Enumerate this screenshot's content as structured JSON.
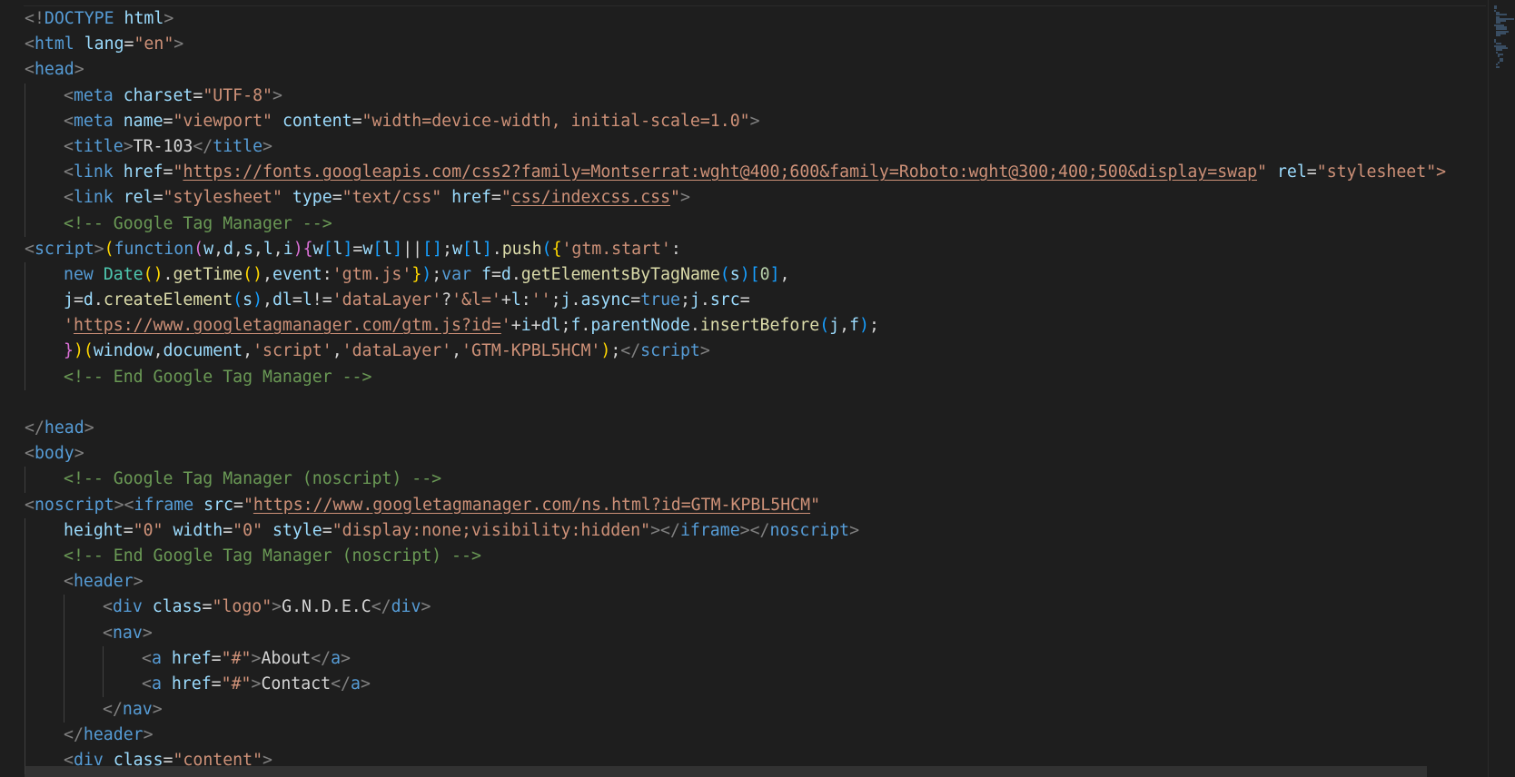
{
  "lines": [
    {
      "indent": 0,
      "tokens": [
        [
          "t-p",
          "<!"
        ],
        [
          "t-tag",
          "DOCTYPE"
        ],
        [
          "t-txt",
          " "
        ],
        [
          "t-attr",
          "html"
        ],
        [
          "t-p",
          ">"
        ]
      ]
    },
    {
      "indent": 0,
      "tokens": [
        [
          "t-p",
          "<"
        ],
        [
          "t-tag",
          "html"
        ],
        [
          "t-txt",
          " "
        ],
        [
          "t-attr",
          "lang"
        ],
        [
          "t-eq",
          "="
        ],
        [
          "t-str",
          "\"en\""
        ],
        [
          "t-p",
          ">"
        ]
      ]
    },
    {
      "indent": 0,
      "tokens": [
        [
          "t-p",
          "<"
        ],
        [
          "t-tag",
          "head"
        ],
        [
          "t-p",
          ">"
        ]
      ]
    },
    {
      "indent": 1,
      "tokens": [
        [
          "t-p",
          "<"
        ],
        [
          "t-tag",
          "meta"
        ],
        [
          "t-txt",
          " "
        ],
        [
          "t-attr",
          "charset"
        ],
        [
          "t-eq",
          "="
        ],
        [
          "t-str",
          "\"UTF-8\""
        ],
        [
          "t-p",
          ">"
        ]
      ]
    },
    {
      "indent": 1,
      "tokens": [
        [
          "t-p",
          "<"
        ],
        [
          "t-tag",
          "meta"
        ],
        [
          "t-txt",
          " "
        ],
        [
          "t-attr",
          "name"
        ],
        [
          "t-eq",
          "="
        ],
        [
          "t-str",
          "\"viewport\""
        ],
        [
          "t-txt",
          " "
        ],
        [
          "t-attr",
          "content"
        ],
        [
          "t-eq",
          "="
        ],
        [
          "t-str",
          "\"width=device-width, initial-scale=1.0\""
        ],
        [
          "t-p",
          ">"
        ]
      ]
    },
    {
      "indent": 1,
      "tokens": [
        [
          "t-p",
          "<"
        ],
        [
          "t-tag",
          "title"
        ],
        [
          "t-p",
          ">"
        ],
        [
          "t-txt",
          "TR-103"
        ],
        [
          "t-p",
          "</"
        ],
        [
          "t-tag",
          "title"
        ],
        [
          "t-p",
          ">"
        ]
      ]
    },
    {
      "indent": 1,
      "tokens": [
        [
          "t-p",
          "<"
        ],
        [
          "t-tag",
          "link"
        ],
        [
          "t-txt",
          " "
        ],
        [
          "t-attr",
          "href"
        ],
        [
          "t-eq",
          "="
        ],
        [
          "t-str",
          "\""
        ],
        [
          "t-url",
          "https://fonts.googleapis.com/css2?family=Montserrat:wght@400;600&family=Roboto:wght@300;400;500&display=swap"
        ],
        [
          "t-str",
          "\""
        ],
        [
          "t-txt",
          " "
        ],
        [
          "t-attr",
          "rel"
        ],
        [
          "t-eq",
          "="
        ],
        [
          "t-str",
          "\"stylesheet\">"
        ]
      ]
    },
    {
      "indent": 1,
      "tokens": [
        [
          "t-p",
          "<"
        ],
        [
          "t-tag",
          "link"
        ],
        [
          "t-txt",
          " "
        ],
        [
          "t-attr",
          "rel"
        ],
        [
          "t-eq",
          "="
        ],
        [
          "t-str",
          "\"stylesheet\""
        ],
        [
          "t-txt",
          " "
        ],
        [
          "t-attr",
          "type"
        ],
        [
          "t-eq",
          "="
        ],
        [
          "t-str",
          "\"text/css\""
        ],
        [
          "t-txt",
          " "
        ],
        [
          "t-attr",
          "href"
        ],
        [
          "t-eq",
          "="
        ],
        [
          "t-str",
          "\""
        ],
        [
          "t-url",
          "css/indexcss.css"
        ],
        [
          "t-str",
          "\""
        ],
        [
          "t-p",
          ">"
        ]
      ]
    },
    {
      "indent": 1,
      "tokens": [
        [
          "t-com",
          "<!-- Google Tag Manager -->"
        ]
      ]
    },
    {
      "indent": 0,
      "tokens": [
        [
          "t-p",
          "<"
        ],
        [
          "t-tag",
          "script"
        ],
        [
          "t-p",
          ">"
        ],
        [
          "t-b1",
          "("
        ],
        [
          "t-kw",
          "function"
        ],
        [
          "t-b2",
          "("
        ],
        [
          "t-var",
          "w"
        ],
        [
          "t-op",
          ","
        ],
        [
          "t-var",
          "d"
        ],
        [
          "t-op",
          ","
        ],
        [
          "t-var",
          "s"
        ],
        [
          "t-op",
          ","
        ],
        [
          "t-var",
          "l"
        ],
        [
          "t-op",
          ","
        ],
        [
          "t-var",
          "i"
        ],
        [
          "t-b2",
          ")"
        ],
        [
          "t-b2",
          "{"
        ],
        [
          "t-var",
          "w"
        ],
        [
          "t-b3",
          "["
        ],
        [
          "t-var",
          "l"
        ],
        [
          "t-b3",
          "]"
        ],
        [
          "t-op",
          "="
        ],
        [
          "t-var",
          "w"
        ],
        [
          "t-b3",
          "["
        ],
        [
          "t-var",
          "l"
        ],
        [
          "t-b3",
          "]"
        ],
        [
          "t-op",
          "||"
        ],
        [
          "t-b3",
          "[]"
        ],
        [
          "t-op",
          ";"
        ],
        [
          "t-var",
          "w"
        ],
        [
          "t-b3",
          "["
        ],
        [
          "t-var",
          "l"
        ],
        [
          "t-b3",
          "]"
        ],
        [
          "t-op",
          "."
        ],
        [
          "t-fn",
          "push"
        ],
        [
          "t-b3",
          "("
        ],
        [
          "t-b1",
          "{"
        ],
        [
          "t-str",
          "'gtm.start'"
        ],
        [
          "t-op",
          ":"
        ]
      ]
    },
    {
      "indent": 1,
      "tokens": [
        [
          "t-kw",
          "new"
        ],
        [
          "t-txt",
          " "
        ],
        [
          "t-cls",
          "Date"
        ],
        [
          "t-b1",
          "()"
        ],
        [
          "t-op",
          "."
        ],
        [
          "t-fn",
          "getTime"
        ],
        [
          "t-b1",
          "()"
        ],
        [
          "t-op",
          ","
        ],
        [
          "t-var",
          "event"
        ],
        [
          "t-op",
          ":"
        ],
        [
          "t-str",
          "'gtm.js'"
        ],
        [
          "t-b1",
          "}"
        ],
        [
          "t-b3",
          ")"
        ],
        [
          "t-op",
          ";"
        ],
        [
          "t-kw",
          "var"
        ],
        [
          "t-txt",
          " "
        ],
        [
          "t-var",
          "f"
        ],
        [
          "t-op",
          "="
        ],
        [
          "t-var",
          "d"
        ],
        [
          "t-op",
          "."
        ],
        [
          "t-fn",
          "getElementsByTagName"
        ],
        [
          "t-b3",
          "("
        ],
        [
          "t-var",
          "s"
        ],
        [
          "t-b3",
          ")"
        ],
        [
          "t-b3",
          "["
        ],
        [
          "t-num",
          "0"
        ],
        [
          "t-b3",
          "]"
        ],
        [
          "t-op",
          ","
        ]
      ]
    },
    {
      "indent": 1,
      "tokens": [
        [
          "t-var",
          "j"
        ],
        [
          "t-op",
          "="
        ],
        [
          "t-var",
          "d"
        ],
        [
          "t-op",
          "."
        ],
        [
          "t-fn",
          "createElement"
        ],
        [
          "t-b3",
          "("
        ],
        [
          "t-var",
          "s"
        ],
        [
          "t-b3",
          ")"
        ],
        [
          "t-op",
          ","
        ],
        [
          "t-var",
          "dl"
        ],
        [
          "t-op",
          "="
        ],
        [
          "t-var",
          "l"
        ],
        [
          "t-op",
          "!="
        ],
        [
          "t-str",
          "'dataLayer'"
        ],
        [
          "t-op",
          "?"
        ],
        [
          "t-str",
          "'&l='"
        ],
        [
          "t-op",
          "+"
        ],
        [
          "t-var",
          "l"
        ],
        [
          "t-op",
          ":"
        ],
        [
          "t-str",
          "''"
        ],
        [
          "t-op",
          ";"
        ],
        [
          "t-var",
          "j"
        ],
        [
          "t-op",
          "."
        ],
        [
          "t-var",
          "async"
        ],
        [
          "t-op",
          "="
        ],
        [
          "t-kw",
          "true"
        ],
        [
          "t-op",
          ";"
        ],
        [
          "t-var",
          "j"
        ],
        [
          "t-op",
          "."
        ],
        [
          "t-var",
          "src"
        ],
        [
          "t-op",
          "="
        ]
      ]
    },
    {
      "indent": 1,
      "tokens": [
        [
          "t-str",
          "'"
        ],
        [
          "t-url",
          "https://www.googletagmanager.com/gtm.js?id="
        ],
        [
          "t-str",
          "'"
        ],
        [
          "t-op",
          "+"
        ],
        [
          "t-var",
          "i"
        ],
        [
          "t-op",
          "+"
        ],
        [
          "t-var",
          "dl"
        ],
        [
          "t-op",
          ";"
        ],
        [
          "t-var",
          "f"
        ],
        [
          "t-op",
          "."
        ],
        [
          "t-var",
          "parentNode"
        ],
        [
          "t-op",
          "."
        ],
        [
          "t-fn",
          "insertBefore"
        ],
        [
          "t-b3",
          "("
        ],
        [
          "t-var",
          "j"
        ],
        [
          "t-op",
          ","
        ],
        [
          "t-var",
          "f"
        ],
        [
          "t-b3",
          ")"
        ],
        [
          "t-op",
          ";"
        ]
      ]
    },
    {
      "indent": 1,
      "tokens": [
        [
          "t-b2",
          "}"
        ],
        [
          "t-b1",
          ")"
        ],
        [
          "t-b1",
          "("
        ],
        [
          "t-var",
          "window"
        ],
        [
          "t-op",
          ","
        ],
        [
          "t-var",
          "document"
        ],
        [
          "t-op",
          ","
        ],
        [
          "t-str",
          "'script'"
        ],
        [
          "t-op",
          ","
        ],
        [
          "t-str",
          "'dataLayer'"
        ],
        [
          "t-op",
          ","
        ],
        [
          "t-str",
          "'GTM-KPBL5HCM'"
        ],
        [
          "t-b1",
          ")"
        ],
        [
          "t-op",
          ";"
        ],
        [
          "t-p",
          "</"
        ],
        [
          "t-tag",
          "script"
        ],
        [
          "t-p",
          ">"
        ]
      ]
    },
    {
      "indent": 1,
      "tokens": [
        [
          "t-com",
          "<!-- End Google Tag Manager -->"
        ]
      ]
    },
    {
      "indent": 0,
      "tokens": []
    },
    {
      "indent": 0,
      "tokens": [
        [
          "t-p",
          "</"
        ],
        [
          "t-tag",
          "head"
        ],
        [
          "t-p",
          ">"
        ]
      ]
    },
    {
      "indent": 0,
      "tokens": [
        [
          "t-p",
          "<"
        ],
        [
          "t-tag",
          "body"
        ],
        [
          "t-p",
          ">"
        ]
      ]
    },
    {
      "indent": 1,
      "tokens": [
        [
          "t-com",
          "<!-- Google Tag Manager (noscript) -->"
        ]
      ]
    },
    {
      "indent": 0,
      "tokens": [
        [
          "t-p",
          "<"
        ],
        [
          "t-tag",
          "noscript"
        ],
        [
          "t-p",
          ">"
        ],
        [
          "t-p",
          "<"
        ],
        [
          "t-tag",
          "iframe"
        ],
        [
          "t-txt",
          " "
        ],
        [
          "t-attr",
          "src"
        ],
        [
          "t-eq",
          "="
        ],
        [
          "t-str",
          "\""
        ],
        [
          "t-url",
          "https://www.googletagmanager.com/ns.html?id=GTM-KPBL5HCM"
        ],
        [
          "t-str",
          "\""
        ]
      ]
    },
    {
      "indent": 1,
      "tokens": [
        [
          "t-attr",
          "height"
        ],
        [
          "t-eq",
          "="
        ],
        [
          "t-str",
          "\"0\""
        ],
        [
          "t-txt",
          " "
        ],
        [
          "t-attr",
          "width"
        ],
        [
          "t-eq",
          "="
        ],
        [
          "t-str",
          "\"0\""
        ],
        [
          "t-txt",
          " "
        ],
        [
          "t-attr",
          "style"
        ],
        [
          "t-eq",
          "="
        ],
        [
          "t-str",
          "\"display:none;visibility:hidden\""
        ],
        [
          "t-p",
          ">"
        ],
        [
          "t-p",
          "</"
        ],
        [
          "t-tag",
          "iframe"
        ],
        [
          "t-p",
          ">"
        ],
        [
          "t-p",
          "</"
        ],
        [
          "t-tag",
          "noscript"
        ],
        [
          "t-p",
          ">"
        ]
      ]
    },
    {
      "indent": 1,
      "tokens": [
        [
          "t-com",
          "<!-- End Google Tag Manager (noscript) -->"
        ]
      ]
    },
    {
      "indent": 1,
      "tokens": [
        [
          "t-p",
          "<"
        ],
        [
          "t-tag",
          "header"
        ],
        [
          "t-p",
          ">"
        ]
      ]
    },
    {
      "indent": 2,
      "tokens": [
        [
          "t-p",
          "<"
        ],
        [
          "t-tag",
          "div"
        ],
        [
          "t-txt",
          " "
        ],
        [
          "t-attr",
          "class"
        ],
        [
          "t-eq",
          "="
        ],
        [
          "t-str",
          "\"logo\""
        ],
        [
          "t-p",
          ">"
        ],
        [
          "t-txt",
          "G.N.D.E.C"
        ],
        [
          "t-p",
          "</"
        ],
        [
          "t-tag",
          "div"
        ],
        [
          "t-p",
          ">"
        ]
      ]
    },
    {
      "indent": 2,
      "tokens": [
        [
          "t-p",
          "<"
        ],
        [
          "t-tag",
          "nav"
        ],
        [
          "t-p",
          ">"
        ]
      ]
    },
    {
      "indent": 3,
      "tokens": [
        [
          "t-p",
          "<"
        ],
        [
          "t-tag",
          "a"
        ],
        [
          "t-txt",
          " "
        ],
        [
          "t-attr",
          "href"
        ],
        [
          "t-eq",
          "="
        ],
        [
          "t-str",
          "\"#\""
        ],
        [
          "t-p",
          ">"
        ],
        [
          "t-txt",
          "About"
        ],
        [
          "t-p",
          "</"
        ],
        [
          "t-tag",
          "a"
        ],
        [
          "t-p",
          ">"
        ]
      ]
    },
    {
      "indent": 3,
      "tokens": [
        [
          "t-p",
          "<"
        ],
        [
          "t-tag",
          "a"
        ],
        [
          "t-txt",
          " "
        ],
        [
          "t-attr",
          "href"
        ],
        [
          "t-eq",
          "="
        ],
        [
          "t-str",
          "\"#\""
        ],
        [
          "t-p",
          ">"
        ],
        [
          "t-txt",
          "Contact"
        ],
        [
          "t-p",
          "</"
        ],
        [
          "t-tag",
          "a"
        ],
        [
          "t-p",
          ">"
        ]
      ]
    },
    {
      "indent": 2,
      "tokens": [
        [
          "t-p",
          "</"
        ],
        [
          "t-tag",
          "nav"
        ],
        [
          "t-p",
          ">"
        ]
      ]
    },
    {
      "indent": 1,
      "tokens": [
        [
          "t-p",
          "</"
        ],
        [
          "t-tag",
          "header"
        ],
        [
          "t-p",
          ">"
        ]
      ]
    },
    {
      "indent": 1,
      "tokens": [
        [
          "t-p",
          "<"
        ],
        [
          "t-tag",
          "div"
        ],
        [
          "t-txt",
          " "
        ],
        [
          "t-attr",
          "class"
        ],
        [
          "t-eq",
          "="
        ],
        [
          "t-str",
          "\"content\""
        ],
        [
          "t-p",
          ">"
        ]
      ]
    }
  ]
}
